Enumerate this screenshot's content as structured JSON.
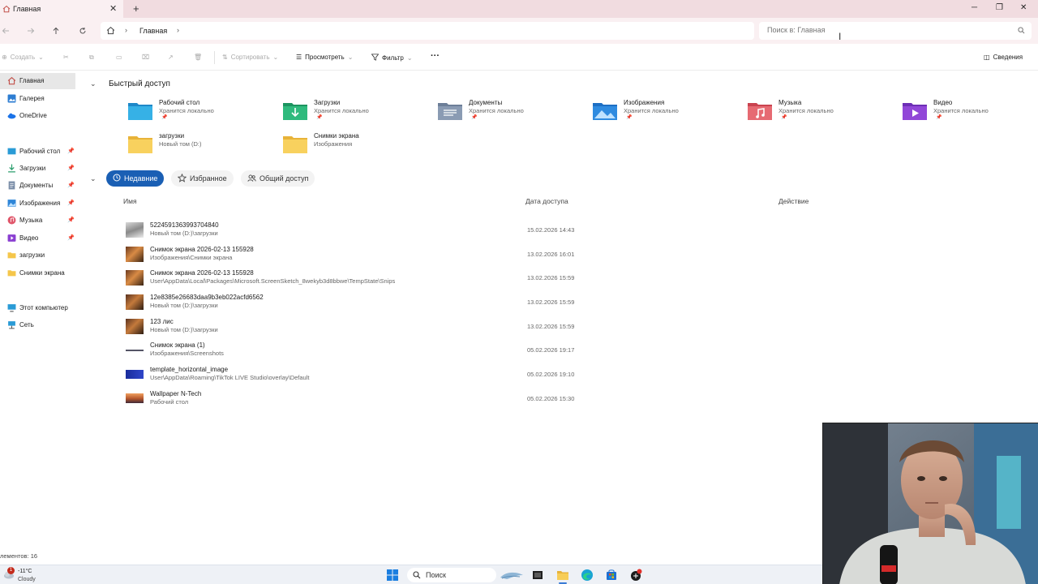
{
  "window": {
    "tab_title": "Главная",
    "new_tab": "+",
    "minimize": "─",
    "maximize": "❐",
    "close": "✕"
  },
  "address": {
    "crumb": "Главная",
    "search_placeholder": "Поиск в: Главная"
  },
  "commands": {
    "create": "Создать",
    "sort": "Сортировать",
    "view": "Просмотреть",
    "filter": "Фильтр",
    "more": "···",
    "details": "Сведения"
  },
  "sidebar": {
    "items": [
      {
        "label": "Главная",
        "icon": "home-icon",
        "selected": true,
        "pinned": false
      },
      {
        "label": "Галерея",
        "icon": "gallery-icon",
        "selected": false,
        "pinned": false
      },
      {
        "label": "OneDrive",
        "icon": "onedrive-icon",
        "selected": false,
        "pinned": false
      },
      {
        "label": "Рабочий стол",
        "icon": "desktop-icon",
        "selected": false,
        "pinned": true
      },
      {
        "label": "Загрузки",
        "icon": "download-icon",
        "selected": false,
        "pinned": true
      },
      {
        "label": "Документы",
        "icon": "documents-icon",
        "selected": false,
        "pinned": true
      },
      {
        "label": "Изображения",
        "icon": "pictures-icon",
        "selected": false,
        "pinned": true
      },
      {
        "label": "Музыка",
        "icon": "music-icon",
        "selected": false,
        "pinned": true
      },
      {
        "label": "Видео",
        "icon": "video-icon",
        "selected": false,
        "pinned": true
      },
      {
        "label": "загрузки",
        "icon": "folder-icon",
        "selected": false,
        "pinned": false
      },
      {
        "label": "Снимки экрана",
        "icon": "folder-icon",
        "selected": false,
        "pinned": false
      },
      {
        "label": "Этот компьютер",
        "icon": "computer-icon",
        "selected": false,
        "pinned": false
      },
      {
        "label": "Сеть",
        "icon": "network-icon",
        "selected": false,
        "pinned": false
      }
    ]
  },
  "quick_access": {
    "title": "Быстрый доступ",
    "tiles": [
      {
        "name": "Рабочий стол",
        "sub": "Хранится локально",
        "pinned": true,
        "icon": "desktop-folder-icon"
      },
      {
        "name": "Загрузки",
        "sub": "Хранится локально",
        "pinned": true,
        "icon": "downloads-folder-icon"
      },
      {
        "name": "Документы",
        "sub": "Хранится локально",
        "pinned": true,
        "icon": "documents-folder-icon"
      },
      {
        "name": "Изображения",
        "sub": "Хранится локально",
        "pinned": true,
        "icon": "pictures-folder-icon"
      },
      {
        "name": "Музыка",
        "sub": "Хранится локально",
        "pinned": true,
        "icon": "music-folder-icon"
      },
      {
        "name": "Видео",
        "sub": "Хранится локально",
        "pinned": true,
        "icon": "video-folder-icon"
      },
      {
        "name": "загрузки",
        "sub": "Новый том (D:)",
        "pinned": false,
        "icon": "yellow-folder-icon"
      },
      {
        "name": "Снимки экрана",
        "sub": "Изображения",
        "pinned": false,
        "icon": "yellow-folder-icon"
      }
    ]
  },
  "recent": {
    "tabs": [
      "Недавние",
      "Избранное",
      "Общий доступ"
    ],
    "columns": {
      "name": "Имя",
      "date": "Дата доступа",
      "action": "Действие"
    },
    "files": [
      {
        "name": "5224591363993704840",
        "path": "Новый том (D:)\\загрузки",
        "date": "15.02.2026 14:43",
        "thumb": "gray"
      },
      {
        "name": "Снимок экрана 2026-02-13 155928",
        "path": "Изображения\\Снимки экрана",
        "date": "13.02.2026 16:01",
        "thumb": "photo"
      },
      {
        "name": "Снимок экрана 2026-02-13 155928",
        "path": "User\\AppData\\Local\\Packages\\Microsoft.ScreenSketch_8wekyb3d8bbwe\\TempState\\Snips",
        "date": "13.02.2026 15:59",
        "thumb": "photo"
      },
      {
        "name": "12e8385e26683daa9b3eb022acfd6562",
        "path": "Новый том (D:)\\загрузки",
        "date": "13.02.2026 15:59",
        "thumb": "photo"
      },
      {
        "name": "123 лис",
        "path": "Новый том (D:)\\загрузки",
        "date": "13.02.2026 15:59",
        "thumb": "photo"
      },
      {
        "name": "Снимок экрана (1)",
        "path": "Изображения\\Screenshots",
        "date": "05.02.2026 19:17",
        "thumb": "screenshot"
      },
      {
        "name": "template_horizontal_image",
        "path": "User\\AppData\\Roaming\\TikTok LIVE Studio\\overlay\\Default",
        "date": "05.02.2026 19:10",
        "thumb": "blue"
      },
      {
        "name": "Wallpaper N-Tech",
        "path": "Рабочий стол",
        "date": "05.02.2026 15:30",
        "thumb": "sunset"
      }
    ]
  },
  "status": {
    "items_count": "лементов: 16"
  },
  "taskbar": {
    "temperature": "-11°C",
    "condition": "Cloudy",
    "badge": "1",
    "search_label": "Поиск"
  }
}
